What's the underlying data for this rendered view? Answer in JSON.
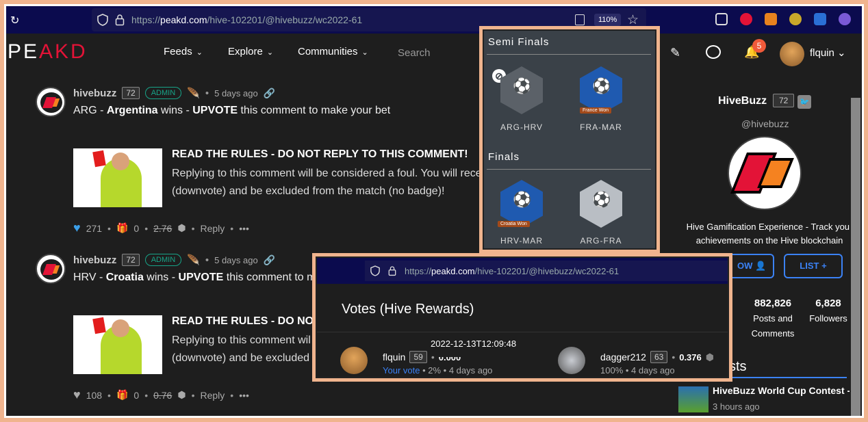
{
  "browser": {
    "url_prefix": "https://",
    "url_host": "peakd.com",
    "url_path": "/hive-102201/@hivebuzz/wc2022-61",
    "zoom": "110%"
  },
  "header": {
    "logo_main": "PE",
    "logo_accent": "A",
    "logo_tail": "KD",
    "nav": [
      "Feeds",
      "Explore",
      "Communities"
    ],
    "search_placeholder": "Search",
    "notifications": "5",
    "username": "flquin"
  },
  "comments": [
    {
      "user": "hivebuzz",
      "rep": "72",
      "role": "ADMIN",
      "ago": "5 days ago",
      "text_pre": "ARG - ",
      "text_team": "Argentina",
      "text_mid": " wins - ",
      "text_upvote": "UPVOTE",
      "text_post": " this comment to make your bet",
      "rules_title": "READ THE RULES - DO NOT REPLY TO THIS COMMENT!",
      "rules_line1": "Replying to this comment will be considered a foul. You will rece",
      "rules_line2": "(downvote) and be excluded from the match (no badge)!",
      "votes": "271",
      "gifts": "0",
      "payout": "2.76",
      "reply": "Reply",
      "more": "•••"
    },
    {
      "user": "hivebuzz",
      "rep": "72",
      "role": "ADMIN",
      "ago": "5 days ago",
      "text_pre": "HRV - ",
      "text_team": "Croatia",
      "text_mid": " wins - ",
      "text_upvote": "UPVOTE",
      "text_post": " this comment to ma",
      "rules_title": "READ THE RULES - DO NOT R",
      "rules_line1": "Replying to this comment wil",
      "rules_line2": "(downvote) and be excluded",
      "votes": "108",
      "gifts": "0",
      "payout": "0.76",
      "reply": "Reply",
      "more": "•••"
    }
  ],
  "sidebar": {
    "name": "HiveBuzz",
    "rep": "72",
    "handle": "@hivebuzz",
    "description": "Hive Gamification Experience - Track your achievements on the Hive blockchain",
    "follow_label": "OW",
    "list_label": "LIST",
    "stats": [
      {
        "value": "882,826",
        "label_1": "Posts and",
        "label_2": "Comments"
      },
      {
        "value": "6,828",
        "label_1": "Followers",
        "label_2": ""
      }
    ],
    "posts_heading": "sts",
    "post_title": "HiveBuzz World Cup Contest -...",
    "post_time": "3 hours ago"
  },
  "badges": {
    "semi_heading": "Semi Finals",
    "finals_heading": "Finals",
    "items": [
      {
        "label": "ARG-HRV",
        "won": ""
      },
      {
        "label": "FRA-MAR",
        "won": "France Won"
      },
      {
        "label": "HRV-MAR",
        "won": "Croatia Won"
      },
      {
        "label": "ARG-FRA",
        "won": ""
      }
    ]
  },
  "votes_popup": {
    "title": "Votes (Hive Rewards)",
    "tooltip": "2022-12-13T12:09:48",
    "voters": [
      {
        "name": "flquin",
        "rep": "59",
        "amount": "0.000",
        "sub_label": "Your vote",
        "percent": "2%",
        "ago": "4 days ago"
      },
      {
        "name": "dagger212",
        "rep": "63",
        "amount": "0.376",
        "sub_label": "",
        "percent": "100%",
        "ago": "4 days ago"
      }
    ]
  },
  "colors": {
    "accent": "#e31337",
    "link": "#3b82f6",
    "admin": "#17a589",
    "frame": "#f0b48e"
  }
}
